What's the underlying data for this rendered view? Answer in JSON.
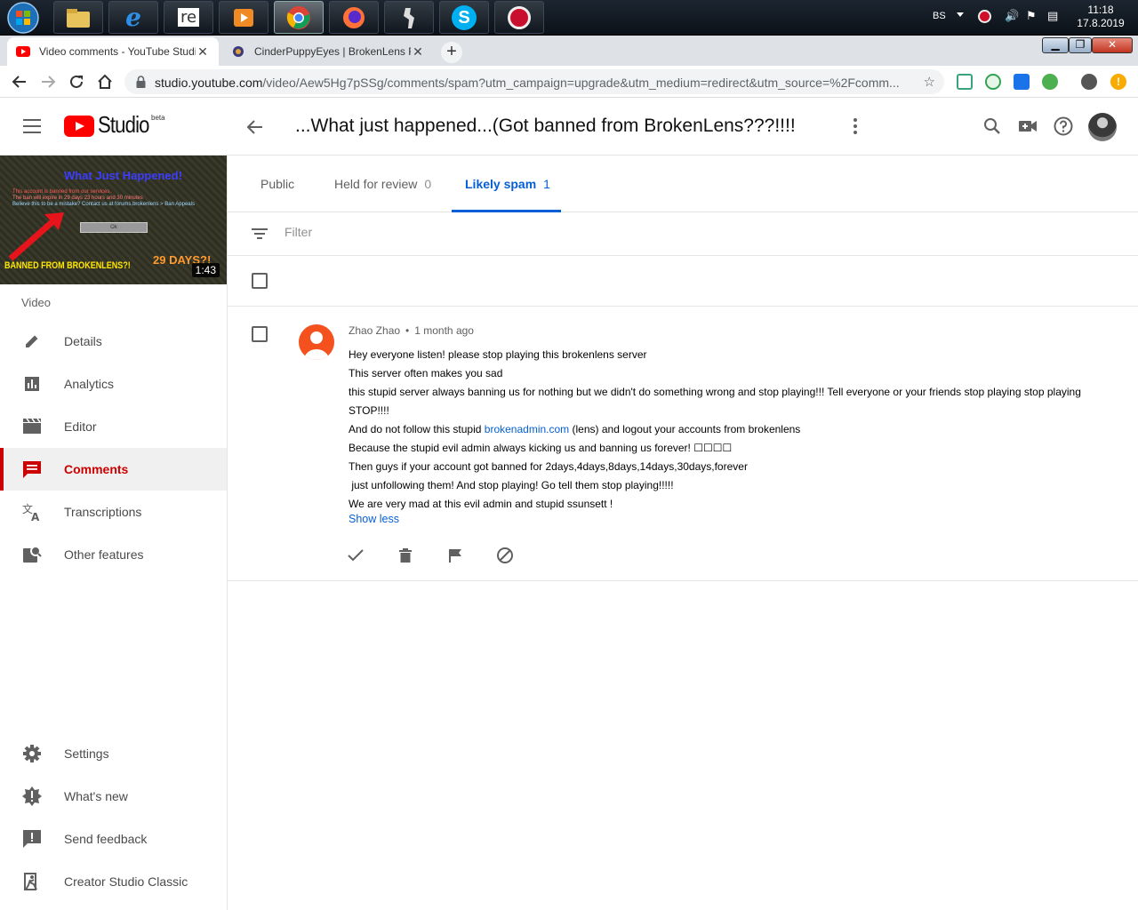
{
  "taskbar": {
    "apps": [
      "file-explorer",
      "internet-explorer",
      "regedit-app",
      "media-player",
      "chrome",
      "firefox",
      "counter-strike",
      "skype",
      "recorder-app"
    ],
    "tray": {
      "lang": "BS",
      "time": "11:18",
      "date": "17.8.2019"
    }
  },
  "browser": {
    "tabs": [
      {
        "title": "Video comments - YouTube Studio",
        "active": true
      },
      {
        "title": "CinderPuppyEyes | BrokenLens Forum",
        "active": false
      }
    ],
    "new_tab_label": "+",
    "url_host": "studio.youtube.com",
    "url_path": "/video/Aew5Hg7pSSg/comments/spam?utm_campaign=upgrade&utm_medium=redirect&utm_source=%2Fcomm..."
  },
  "header": {
    "studio_word": "Studio",
    "beta": "beta",
    "title": "...What just happened...(Got banned from BrokenLens???!!!!"
  },
  "sidebar": {
    "thumbnail": {
      "title": "What Just Happened!",
      "line1": "This account is banned from our services.",
      "line2": "The ban will expire in 29 days 23 hours and 30 minutes",
      "line3": "Believe this to be a mistake? Contact us at forums.brokenlens > Ban Appeals",
      "button": "Ok",
      "banned_caption": "BANNED FROM BROKENLENS?!",
      "days_caption": "29 DAYS?!",
      "duration": "1:43"
    },
    "section_label": "Video",
    "items": [
      {
        "label": "Details",
        "icon": "pencil-icon"
      },
      {
        "label": "Analytics",
        "icon": "analytics-icon"
      },
      {
        "label": "Editor",
        "icon": "clapperboard-icon"
      },
      {
        "label": "Comments",
        "icon": "comment-icon",
        "active": true
      },
      {
        "label": "Transcriptions",
        "icon": "translate-icon"
      },
      {
        "label": "Other features",
        "icon": "other-features-icon"
      }
    ],
    "bottom_items": [
      {
        "label": "Settings",
        "icon": "gear-icon"
      },
      {
        "label": "What's new",
        "icon": "whats-new-icon"
      },
      {
        "label": "Send feedback",
        "icon": "feedback-icon"
      },
      {
        "label": "Creator Studio Classic",
        "icon": "exit-icon"
      }
    ]
  },
  "tabs": [
    {
      "label": "Public",
      "count": ""
    },
    {
      "label": "Held for review",
      "count": "0"
    },
    {
      "label": "Likely spam",
      "count": "1",
      "active": true
    }
  ],
  "filter": {
    "placeholder": "Filter"
  },
  "comment": {
    "author": "Zhao Zhao",
    "separator": "•",
    "time": "1 month ago",
    "lines": [
      "Hey everyone listen! please stop playing this brokenlens server",
      "This server often makes you sad",
      "this stupid server always banning us for nothing but we didn't do something wrong and stop playing!!! Tell everyone or your friends stop playing stop playing STOP!!!!",
      "And do not follow this stupid",
      "Because the stupid evil admin always kicking us and banning us forever! ☐☐☐☐",
      "Then guys if your account got banned for 2days,4days,8days,14days,30days,forever",
      " just unfollowing them! And stop playing! Go tell them stop playing!!!!!",
      "We are very mad at this evil admin and stupid ssunsett !"
    ],
    "link_text": "brokenadmin.com",
    "line4_suffix": " (lens)  and logout your accounts from brokenlens",
    "show_less": "Show less"
  },
  "colors": {
    "accent_blue": "#065fd4",
    "yt_red": "#ff0000",
    "active_red": "#cc0000",
    "avatar_orange": "#f4511e"
  }
}
